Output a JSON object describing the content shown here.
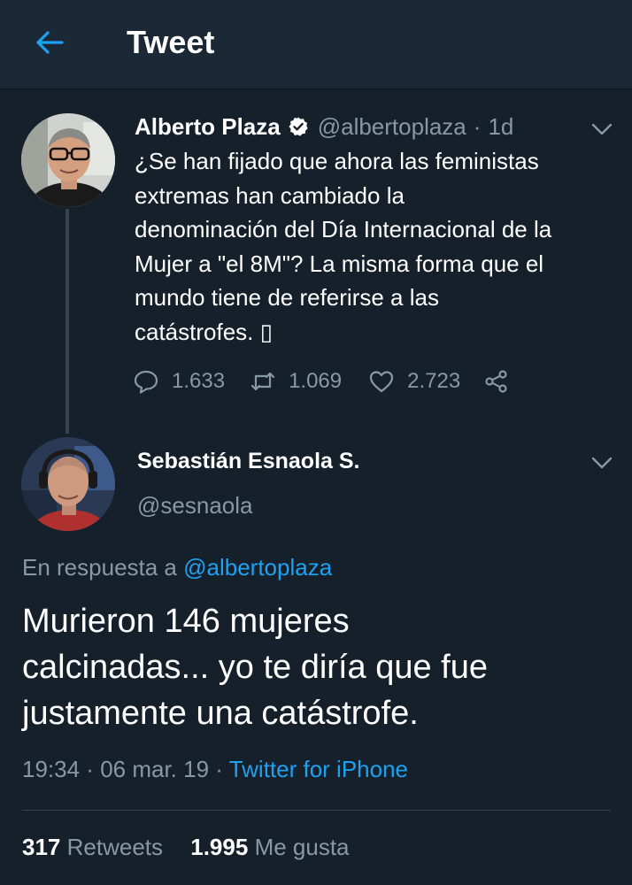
{
  "header": {
    "title": "Tweet",
    "back_icon": "arrow-left-icon",
    "accent_color": "#1da1f2"
  },
  "original_tweet": {
    "author_name": "Alberto Plaza",
    "verified": true,
    "handle": "@albertoplaza",
    "separator": "·",
    "time": "1d",
    "text": "¿Se han fijado que ahora las feministas\nextremas han cambiado la\ndenominación del Día Internacional de la\nMujer a \"el 8M\"? La misma forma que el\nmundo tiene de referirse a las\ncatástrofes. ▯",
    "replies": "1.633",
    "retweets": "1.069",
    "likes": "2.723"
  },
  "reply_tweet": {
    "author_name": "Sebastián Esnaola S.",
    "handle": "@sesnaola",
    "in_reply_prefix": "En respuesta a ",
    "in_reply_handle": "@albertoplaza",
    "text": "Murieron 146 mujeres\ncalcinadas... yo te diría que fue\njustamente una catástrofe.",
    "time": "19:34",
    "separator1": " · ",
    "date": "06 mar. 19",
    "separator2": " · ",
    "source": "Twitter for iPhone",
    "retweets_count": "317",
    "retweets_label": "Retweets",
    "likes_count": "1.995",
    "likes_label": "Me gusta"
  },
  "colors": {
    "background": "#15202b",
    "header_bg": "#1b2836",
    "muted": "#8899a6",
    "link": "#1da1f2"
  }
}
